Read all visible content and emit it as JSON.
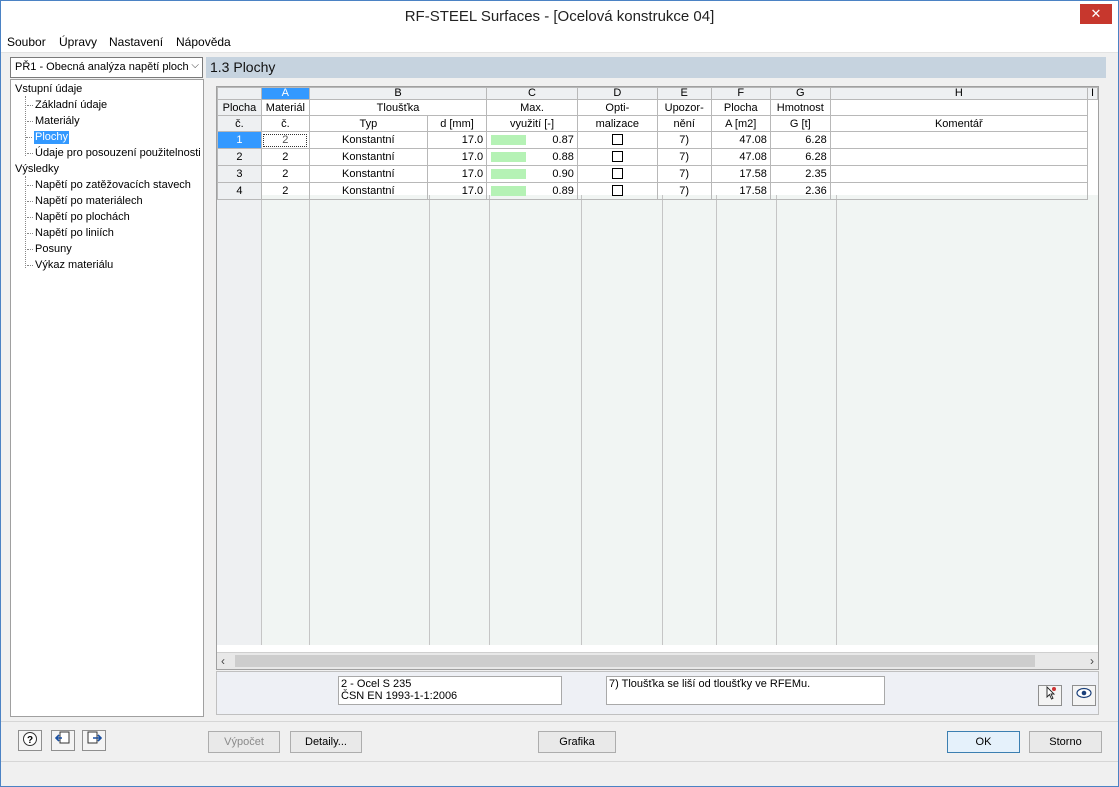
{
  "window": {
    "title": "RF-STEEL Surfaces - [Ocelová konstrukce 04]"
  },
  "menu": [
    {
      "label": "Soubor"
    },
    {
      "label": "Úpravy"
    },
    {
      "label": "Nastavení"
    },
    {
      "label": "Nápověda"
    }
  ],
  "nav": {
    "selected": "PŘ1 - Obecná analýza napětí ploch"
  },
  "tree": {
    "input_group": "Vstupní údaje",
    "input_items": [
      "Základní údaje",
      "Materiály",
      "Plochy",
      "Údaje pro posouzení použitelnosti"
    ],
    "results_group": "Výsledky",
    "result_items": [
      "Napětí po zatěžovacích stavech",
      "Napětí po materiálech",
      "Napětí po plochách",
      "Napětí po liniích",
      "Posuny",
      "Výkaz materiálu"
    ],
    "selected_item": "Plochy"
  },
  "section": {
    "title": "1.3 Plochy"
  },
  "grid": {
    "col_letters": [
      "A",
      "B",
      "C",
      "D",
      "E",
      "F",
      "G",
      "H",
      "I"
    ],
    "header": {
      "surface_1": "Plocha",
      "surface_2": "č.",
      "material_1": "Materiál",
      "material_2": "č.",
      "thickness": "Tloušťka",
      "type": "Typ",
      "d": "d [mm]",
      "util_1": "Max.",
      "util_2": "využití [-]",
      "opt_1": "Opti-",
      "opt_2": "malizace",
      "warn_1": "Upozor-",
      "warn_2": "nění",
      "area_1": "Plocha",
      "area_2": "A [m2]",
      "mass_1": "Hmotnost",
      "mass_2": "G [t]",
      "comment": "Komentář"
    },
    "rows": [
      {
        "no": "1",
        "material": "2",
        "type": "Konstantní",
        "d": "17.0",
        "util": "0.87",
        "warn": "7)",
        "area": "47.08",
        "mass": "6.28",
        "comment": ""
      },
      {
        "no": "2",
        "material": "2",
        "type": "Konstantní",
        "d": "17.0",
        "util": "0.88",
        "warn": "7)",
        "area": "47.08",
        "mass": "6.28",
        "comment": ""
      },
      {
        "no": "3",
        "material": "2",
        "type": "Konstantní",
        "d": "17.0",
        "util": "0.90",
        "warn": "7)",
        "area": "17.58",
        "mass": "2.35",
        "comment": ""
      },
      {
        "no": "4",
        "material": "2",
        "type": "Konstantní",
        "d": "17.0",
        "util": "0.89",
        "warn": "7)",
        "area": "17.58",
        "mass": "2.36",
        "comment": ""
      }
    ]
  },
  "info": {
    "material_line1": "2 - Ocel S 235",
    "material_line2": "ČSN EN 1993-1-1:2006",
    "note": "7) Tloušťka se liší od tloušťky ve RFEMu."
  },
  "buttons": {
    "calc": "Výpočet",
    "details": "Detaily...",
    "graphics": "Grafika",
    "ok": "OK",
    "cancel": "Storno"
  },
  "colors": {
    "selection": "#3399ff",
    "util_bar": "#b5f2b5",
    "header_bg": "#c6d3df"
  }
}
